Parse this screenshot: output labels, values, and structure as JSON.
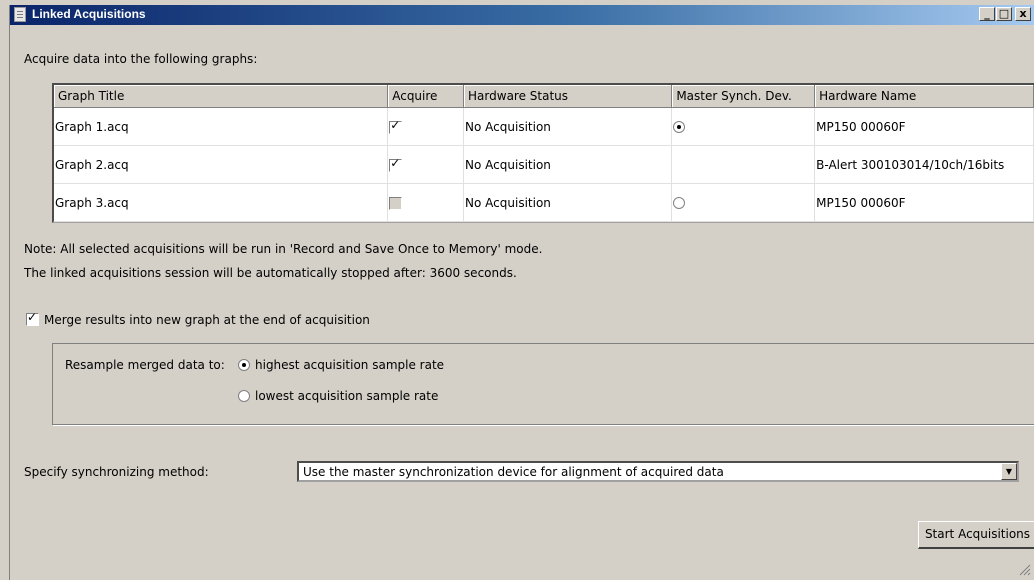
{
  "window": {
    "title": "Linked Acquisitions",
    "minimize_glyph": "_",
    "maximize_glyph": "□",
    "close_glyph": "x"
  },
  "acquire_label": "Acquire data into the following graphs:",
  "table": {
    "columns": [
      "Graph Title",
      "Acquire",
      "Hardware Status",
      "Master Synch. Dev.",
      "Hardware Name"
    ],
    "rows": [
      {
        "title": "Graph 1.acq",
        "acquire": true,
        "acquire_enabled": true,
        "status": "No Acquisition",
        "master": "selected",
        "hardware": "MP150 00060F"
      },
      {
        "title": "Graph 2.acq",
        "acquire": true,
        "acquire_enabled": true,
        "status": "No Acquisition",
        "master": "none",
        "hardware": "B-Alert 300103014/10ch/16bits"
      },
      {
        "title": "Graph 3.acq",
        "acquire": false,
        "acquire_enabled": false,
        "status": "No Acquisition",
        "master": "unselected",
        "hardware": "MP150 00060F"
      }
    ]
  },
  "notes": {
    "line1": "Note: All selected acquisitions will be run in 'Record and Save Once to Memory' mode.",
    "line2": "The linked acquisitions session will be automatically stopped after: 3600 seconds."
  },
  "merge": {
    "label": "Merge results into new graph at the end of acquisition",
    "checked": true
  },
  "resample": {
    "label": "Resample merged data to:",
    "options": [
      {
        "label": "highest acquisition sample rate",
        "selected": true
      },
      {
        "label": "lowest acquisition sample rate",
        "selected": false
      }
    ]
  },
  "sync": {
    "label": "Specify synchronizing method:",
    "value": "Use the master synchronization device for alignment of acquired data"
  },
  "start_button": "Start Acquisitions",
  "icons": {
    "checkmark": "check-icon",
    "dropdown": "chevron-down-icon",
    "app": "document-icon"
  }
}
